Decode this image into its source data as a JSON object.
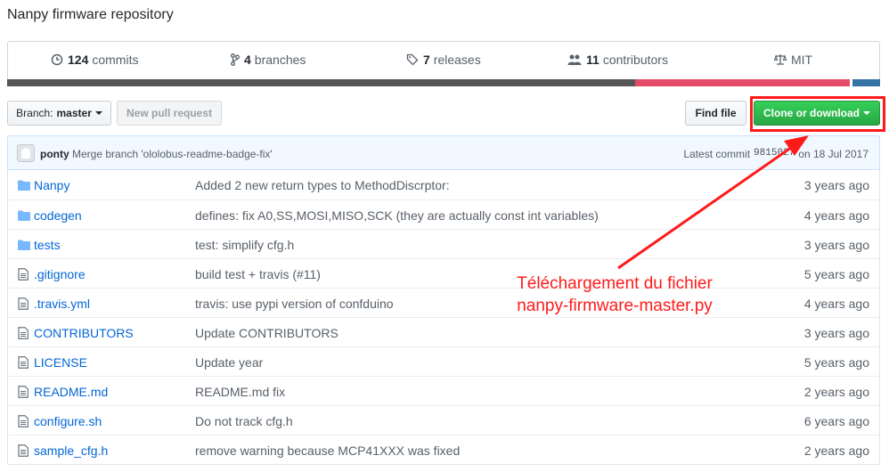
{
  "repo": {
    "description": "Nanpy firmware repository"
  },
  "summary": [
    {
      "num": "124",
      "label": "commits",
      "icon": "history-icon"
    },
    {
      "num": "4",
      "label": "branches",
      "icon": "branch-icon"
    },
    {
      "num": "7",
      "label": "releases",
      "icon": "tag-icon"
    },
    {
      "num": "11",
      "label": "contributors",
      "icon": "people-icon"
    },
    {
      "num": "",
      "label": "MIT",
      "icon": "law-icon"
    }
  ],
  "languages": {
    "colors": [
      "#555555",
      "#e44b68",
      "#3572a5"
    ]
  },
  "toolbar": {
    "branch_label": "Branch:",
    "branch_value": "master",
    "new_pr": "New pull request",
    "find_file": "Find file",
    "clone": "Clone or download"
  },
  "commit": {
    "author": "ponty",
    "message": "Merge branch 'ololobus-readme-badge-fix'",
    "latest_label": "Latest commit",
    "sha": "9815027",
    "date": "on 18 Jul 2017"
  },
  "files": [
    {
      "type": "dir",
      "name": "Nanpy",
      "message": "Added 2 new return types to MethodDiscrptor:",
      "age": "3 years ago"
    },
    {
      "type": "dir",
      "name": "codegen",
      "message": "defines: fix A0,SS,MOSI,MISO,SCK (they are actually const int variables)",
      "age": "4 years ago"
    },
    {
      "type": "dir",
      "name": "tests",
      "message": "test: simplify cfg.h",
      "age": "3 years ago"
    },
    {
      "type": "file",
      "name": ".gitignore",
      "message": "build test + travis (#11)",
      "age": "5 years ago"
    },
    {
      "type": "file",
      "name": ".travis.yml",
      "message": "travis: use pypi version of confduino",
      "age": "4 years ago"
    },
    {
      "type": "file",
      "name": "CONTRIBUTORS",
      "message": "Update CONTRIBUTORS",
      "age": "3 years ago"
    },
    {
      "type": "file",
      "name": "LICENSE",
      "message": "Update year",
      "age": "5 years ago"
    },
    {
      "type": "file",
      "name": "README.md",
      "message": "README.md fix",
      "age": "2 years ago"
    },
    {
      "type": "file",
      "name": "configure.sh",
      "message": "Do not track cfg.h",
      "age": "6 years ago"
    },
    {
      "type": "file",
      "name": "sample_cfg.h",
      "message": "remove warning because MCP41XXX was fixed",
      "age": "2 years ago"
    }
  ],
  "annotation": {
    "line1": "Téléchargement du fichier",
    "line2": "nanpy-firmware-master.py",
    "color": "#ff1a1a"
  }
}
